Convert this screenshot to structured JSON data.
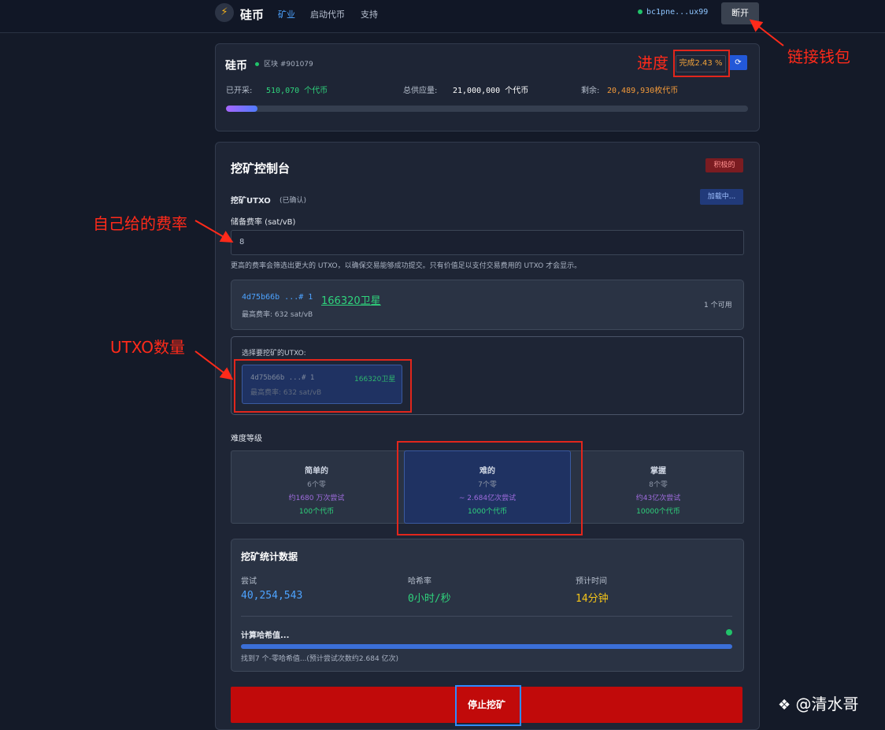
{
  "nav": {
    "logo_glyph": "⚡",
    "brand": "硅币",
    "links": [
      "矿业",
      "启动代币",
      "支持"
    ],
    "active_link": "矿业",
    "wallet": "bc1pne...ux99",
    "disconnect_label": "断开"
  },
  "status": {
    "title": "硅币",
    "block": "区块 #901079",
    "progress": "完成2.43 %",
    "progress_fraction": 0.0243,
    "refresh_glyph": "⟳",
    "mined_label": "已开采:",
    "mined_value": "510,070 个代币",
    "supply_label": "总供应量:",
    "supply_value": "21,000,000 个代币",
    "remaining_label": "剩余:",
    "remaining_value": "20,489,930枚代币"
  },
  "console": {
    "title": "挖矿控制台",
    "active_badge": "积极的",
    "utxo_label": "挖矿UTXO",
    "utxo_confirmed": "(已确认)",
    "loading_button": "加载中...",
    "fee_label": "储备费率 (sat/vB)",
    "fee_value": "8",
    "fee_hint": "更高的费率会筛选出更大的 UTXO，以确保交易能够成功提交。只有价值足以支付交易费用的 UTXO 才会显示。",
    "utxo_summary": {
      "id": "4d75b66b ...# 1",
      "sats": "166320卫星",
      "max_fee": "最高费率: 632 sat/vB",
      "available": "1 个可用"
    },
    "select_label": "选择要挖矿的UTXO:",
    "utxo_option": {
      "id": "4d75b66b ...# 1",
      "sats": "166320卫星",
      "max_fee": "最高费率: 632 sat/vB"
    },
    "difficulty_label": "难度等级",
    "difficulties": [
      {
        "name": "简单的",
        "zeros": "6个零",
        "tries": "约1680 万次尝试",
        "reward": "100个代币"
      },
      {
        "name": "难的",
        "zeros": "7个零",
        "tries": "~ 2.684亿次尝试",
        "reward": "1000个代币"
      },
      {
        "name": "掌握",
        "zeros": "8个零",
        "tries": "约43亿次尝试",
        "reward": "10000个代币"
      }
    ],
    "selected_difficulty": "难的"
  },
  "stats": {
    "title": "挖矿统计数据",
    "attempts_label": "尝试",
    "attempts_value": "40,254,543",
    "hashrate_label": "哈希率",
    "hashrate_value": "0小时/秒",
    "eta_label": "预计时间",
    "eta_value": "14分钟",
    "computing_label": "计算哈希值...",
    "computing_detail": "找到7 个-零哈希值...(预计尝试次数约2.684 亿次)"
  },
  "stop_button": "停止挖矿",
  "annotations": {
    "progress": "进度",
    "wallet": "链接钱包",
    "fee": "自己给的费率",
    "utxo_count": "UTXO数量"
  },
  "watermark": "@清水哥",
  "colors": {
    "accent_blue": "#4da3ff",
    "success_green": "#2fd37c",
    "warning_orange": "#f39a3a",
    "danger_red": "#c10a0a",
    "annotation_red": "#ff2a1a"
  }
}
